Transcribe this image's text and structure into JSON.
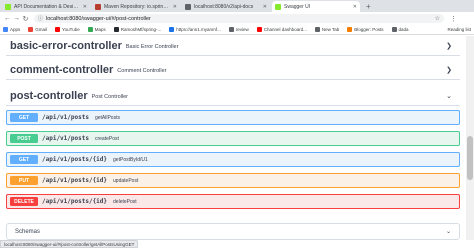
{
  "browser": {
    "tabs": [
      {
        "label": "API Documentation & Design Tools",
        "favicon_color": "#85ea2d",
        "active": false
      },
      {
        "label": "Maven Repository: io.springfox",
        "favicon_color": "#b73f2e",
        "active": false
      },
      {
        "label": "localhost:8080/v2/api-docs",
        "favicon_color": "#5f6368",
        "active": false
      },
      {
        "label": "Swagger UI",
        "favicon_color": "#85ea2d",
        "active": true
      }
    ],
    "url": "localhost:8080/swagger-ui/#/post-controller",
    "bookmarks": [
      {
        "label": "Apps",
        "icon_color": "#4285f4"
      },
      {
        "label": "Gmail",
        "icon_color": "#ea4335"
      },
      {
        "label": "YouTube",
        "icon_color": "#ff0000"
      },
      {
        "label": "Maps",
        "icon_color": "#34a853"
      },
      {
        "label": "RamoshMf/spring-...",
        "icon_color": "#24292e"
      },
      {
        "label": "https://ann1.myanmf...",
        "icon_color": "#1a73e8"
      },
      {
        "label": "review",
        "icon_color": "#5f6368"
      },
      {
        "label": "Channel dashboard...",
        "icon_color": "#ff0000"
      },
      {
        "label": "New Tab",
        "icon_color": "#5f6368"
      },
      {
        "label": "Blogger: Posts",
        "icon_color": "#f57d00"
      },
      {
        "label": "dada",
        "icon_color": "#5f6368"
      }
    ],
    "reading_list": "Reading list"
  },
  "controllers": [
    {
      "name": "basic-error-controller",
      "description": "Basic Error Controller",
      "expanded": false
    },
    {
      "name": "comment-controller",
      "description": "Comment Controller",
      "expanded": false
    },
    {
      "name": "post-controller",
      "description": "Post Controller",
      "expanded": true
    }
  ],
  "operations": [
    {
      "method": "GET",
      "path": "/api/v1/posts",
      "summary": "getAllPosts",
      "style": "get"
    },
    {
      "method": "POST",
      "path": "/api/v1/posts",
      "summary": "createPost",
      "style": "post"
    },
    {
      "method": "GET",
      "path": "/api/v1/posts/{id}",
      "summary": "getPostById/U1",
      "style": "get"
    },
    {
      "method": "PUT",
      "path": "/api/v1/posts/{id}",
      "summary": "updatePost",
      "style": "put"
    },
    {
      "method": "DELETE",
      "path": "/api/v1/posts/{id}",
      "summary": "deletePost",
      "style": "delete"
    }
  ],
  "schemas": {
    "label": "Schemas"
  },
  "status_bar": "localhost:8080/swagger-ui/#/post-controller/getAllPostsUsingGET"
}
